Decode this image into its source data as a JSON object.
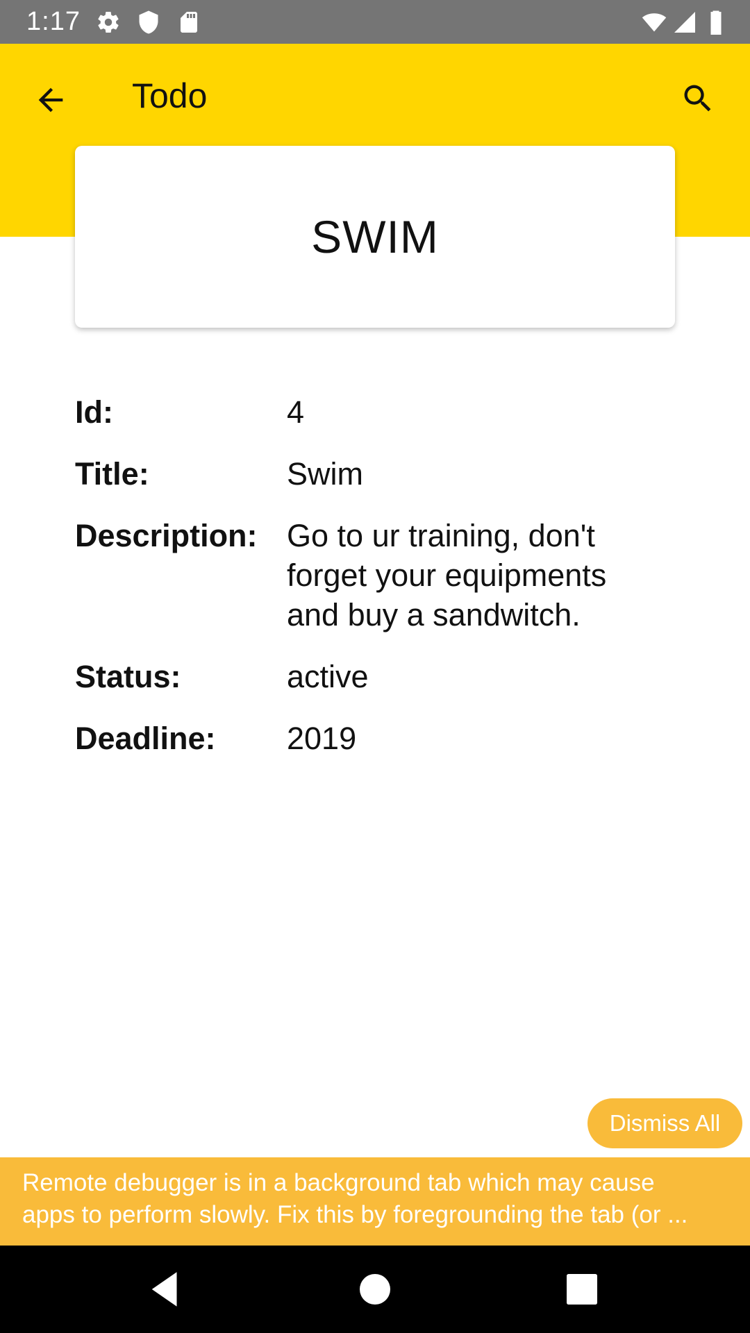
{
  "status_bar": {
    "time": "1:17",
    "icons": [
      "gear-icon",
      "shield-icon",
      "sd-card-icon",
      "wifi-icon",
      "signal-icon",
      "battery-icon"
    ]
  },
  "app_bar": {
    "title": "Todo",
    "background_color": "#ffd600",
    "back_icon": "arrow-back-icon",
    "search_icon": "search-icon"
  },
  "card": {
    "title": "SWIM"
  },
  "details": [
    {
      "label": "Id:",
      "value": "4"
    },
    {
      "label": "Title:",
      "value": "Swim"
    },
    {
      "label": "Description:",
      "value": "Go to ur training, don't forget your equipments and buy a sandwitch."
    },
    {
      "label": "Status:",
      "value": "active"
    },
    {
      "label": "Deadline:",
      "value": "2019"
    }
  ],
  "dismiss": {
    "label": "Dismiss All"
  },
  "warning": {
    "line1": "Remote debugger is in a background tab which may cause",
    "line2": "apps to perform slowly. Fix this by foregrounding the tab (or ..."
  },
  "colors": {
    "accent": "#ffd600",
    "warning": "#f9bb3a",
    "status_bar": "#757575"
  }
}
